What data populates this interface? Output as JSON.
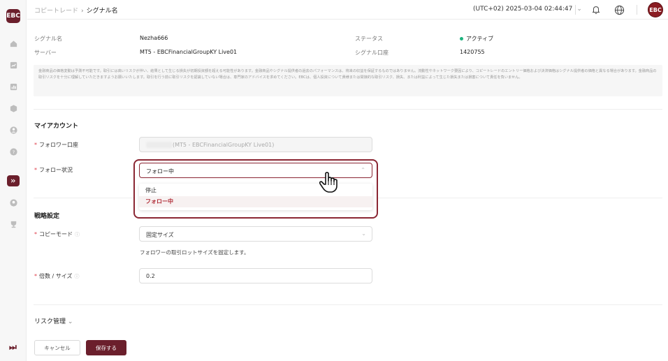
{
  "sidebar": {
    "logo_text": "EBC",
    "icons": [
      "home-icon",
      "chart-icon",
      "bar-chart-icon",
      "cube-icon",
      "user-icon",
      "help-icon",
      "signal-icon",
      "profile-icon",
      "trophy-icon"
    ],
    "bottom_icon_glyph": "⏭"
  },
  "topbar": {
    "breadcrumb_parent": "コピートレード",
    "breadcrumb_sep": "›",
    "breadcrumb_current": "シグナル名",
    "clock": "(UTC+02)  2025-03-04 02:44:47",
    "avatar_text": "EBC"
  },
  "info": {
    "signal_label": "シグナル名",
    "signal_value": "Nezha666",
    "server_label": "サーバー",
    "server_value": "MT5 - EBCFinancialGroupKY Live01",
    "status_label": "ステータス",
    "status_value": "アクティブ",
    "account_label": "シグナル口座",
    "account_value": "1420755"
  },
  "disclaimer": "金融商品の価格変動は予測不可能です。取引には高いリスクが伴い、結果として生じる損失が初期投資額を超える可能性があります。金融商品やシグナル提供者の過去のパフォーマンスは、将来の収益を保証するものではありません。流動性やネットワーク要因により、コピートレードのエントリー価格および決済価格はシグナル提供者の価格と異なる場合があります。金融商品の取引リスクを十分に理解していただきますようお願いいたします。取引を行う前に取引リスクを認識していない場合は、専門家のアドバイスを求めてください。EBCは、個人投資について貴様または間接的な取引リスク、損失、または利益によって生じた損失または損害について責任を負いません。",
  "my_account": {
    "title": "マイアカウント",
    "follower_account_label": "フォロワー口座",
    "follower_account_value": "(MT5 - EBCFinancialGroupKY Live01)",
    "follow_status_label": "フォロー状況",
    "follow_status_value": "フォロー中",
    "options": [
      "停止",
      "フォロー中"
    ]
  },
  "strategy": {
    "title": "戦略設定",
    "copy_mode_label": "コピーモード",
    "copy_mode_value": "固定サイズ",
    "copy_mode_hint": "フォロワーの取引ロットサイズを固定します。",
    "multiplier_label": "倍数 / サイズ",
    "multiplier_value": "0.2"
  },
  "risk": {
    "title": "リスク管理"
  },
  "buttons": {
    "cancel": "キャンセル",
    "save": "保存する"
  },
  "colors": {
    "brand": "#6b1f2c",
    "status_active": "#1db37e",
    "required": "#e0414d"
  }
}
